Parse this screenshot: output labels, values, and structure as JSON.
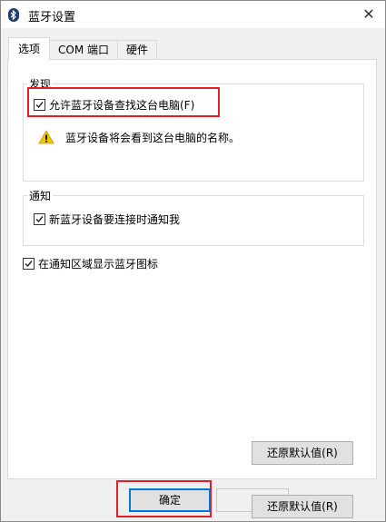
{
  "window": {
    "title": "蓝牙设置",
    "close_glyph": "✕"
  },
  "tabs": [
    {
      "label": "选项",
      "active": true
    },
    {
      "label": "COM 端口",
      "active": false
    },
    {
      "label": "硬件",
      "active": false
    }
  ],
  "discovery": {
    "legend": "发现",
    "allow_find": {
      "label": "允许蓝牙设备查找这台电脑(F)",
      "checked": true
    },
    "warning_text": "蓝牙设备将会看到这台电脑的名称。"
  },
  "notify": {
    "legend": "通知",
    "new_device": {
      "label": "新蓝牙设备要连接时通知我",
      "checked": true
    }
  },
  "tray": {
    "label": "在通知区域显示蓝牙图标",
    "checked": true
  },
  "buttons": {
    "restore_defaults_panel": "还原默认值(R)",
    "ok": "确定",
    "restore_defaults_bottom": "还原默认值(R)"
  },
  "colors": {
    "highlight": "#e21f26",
    "primary_border": "#0078d7",
    "warning_fill": "#f2c500"
  }
}
